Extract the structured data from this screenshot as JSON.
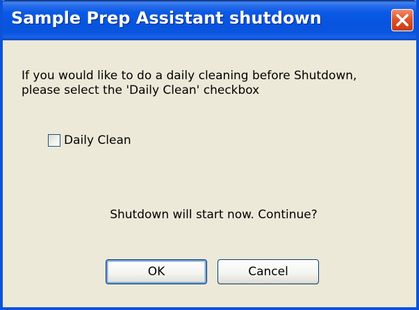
{
  "dialog": {
    "title": "Sample Prep Assistant shutdown",
    "message_line1": "If you would like to do a daily cleaning before Shutdown,",
    "message_line2": "please select the 'Daily Clean' checkbox",
    "checkbox": {
      "label": "Daily Clean",
      "checked": false
    },
    "question": "Shutdown will start now. Continue?",
    "buttons": {
      "ok_label": "OK",
      "cancel_label": "Cancel"
    },
    "icons": {
      "close": "close-icon"
    },
    "colors": {
      "titlebar": "#0754e0",
      "body_bg": "#ece9d8",
      "close_button": "#e0532a"
    }
  }
}
